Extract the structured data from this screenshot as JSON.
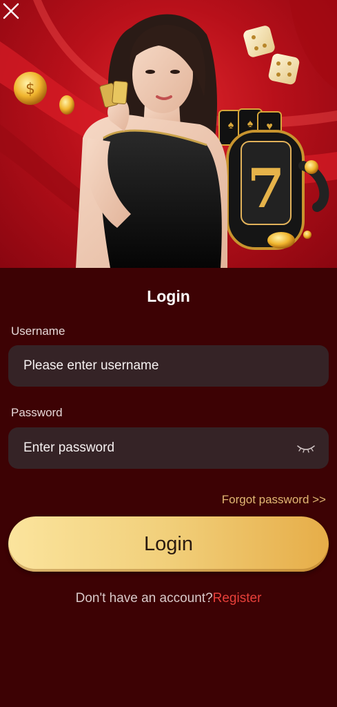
{
  "header": {
    "close_icon": "close-icon"
  },
  "hero": {
    "image": "casino-promo-banner",
    "colors": {
      "background": "#c0121c",
      "gold": "#e9b94a"
    }
  },
  "form": {
    "title": "Login",
    "username": {
      "label": "Username",
      "placeholder": "Please enter username",
      "value": ""
    },
    "password": {
      "label": "Password",
      "placeholder": "Enter password",
      "value": "",
      "toggle_icon": "eye-closed-icon"
    },
    "forgot_label": "Forgot password >>",
    "login_label": "Login",
    "register_prompt": "Don't have an account?",
    "register_label": "Register"
  },
  "colors": {
    "page_background": "#3d0204",
    "field_background": "#352326",
    "accent_gold": "#e2b874",
    "register_red": "#e8403a"
  }
}
